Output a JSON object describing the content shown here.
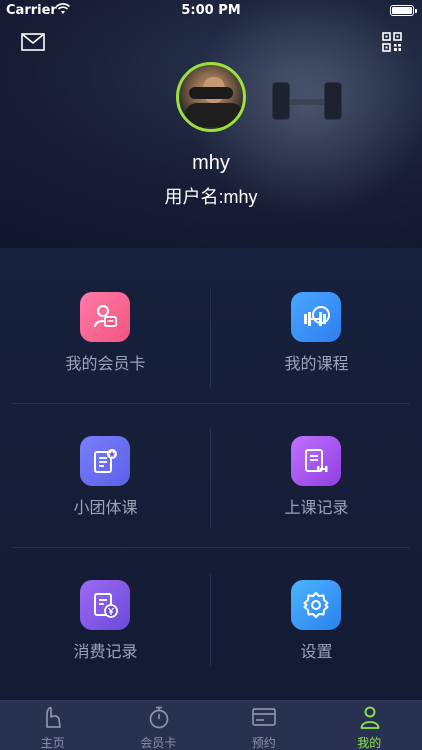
{
  "status_bar": {
    "carrier": "Carrier",
    "time": "5:00 PM"
  },
  "profile": {
    "nickname": "mhy",
    "username": "用户名:mhy"
  },
  "menu": [
    {
      "label": "我的会员卡",
      "icon": "member-card-icon",
      "color": "#f2567f"
    },
    {
      "label": "我的课程",
      "icon": "course-icon",
      "color": "#2e7ef0"
    },
    {
      "label": "小团体课",
      "icon": "group-class-icon",
      "color": "#5b61e8"
    },
    {
      "label": "上课记录",
      "icon": "class-record-icon",
      "color": "#8f3fe0"
    },
    {
      "label": "消费记录",
      "icon": "consumption-record-icon",
      "color": "#6a4ad8"
    },
    {
      "label": "设置",
      "icon": "settings-icon",
      "color": "#2a82ee"
    }
  ],
  "tabs": [
    {
      "label": "主页",
      "icon": "home-icon"
    },
    {
      "label": "会员卡",
      "icon": "stopwatch-icon"
    },
    {
      "label": "预约",
      "icon": "card-icon"
    },
    {
      "label": "我的",
      "icon": "person-icon",
      "active": true
    }
  ],
  "colors": {
    "accent": "#8ee64a",
    "background": "#141b34",
    "tabbar": "#283150"
  }
}
